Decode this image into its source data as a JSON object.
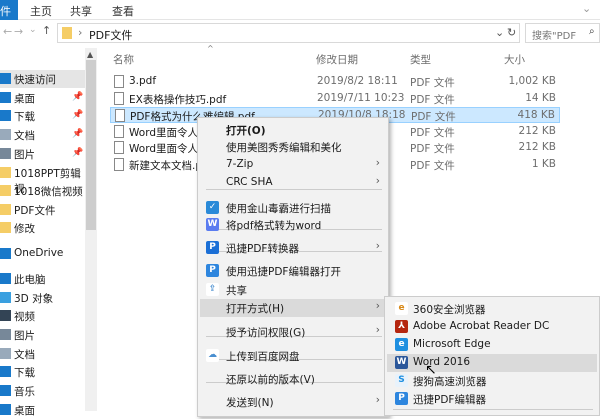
{
  "ribbon": {
    "file_tab": "件",
    "tabs": [
      "主页",
      "共享",
      "查看"
    ]
  },
  "address": {
    "path": "PDF文件",
    "search_placeholder": "搜索\"PDF"
  },
  "nav": {
    "items": [
      {
        "label": "快速访问",
        "pin": false
      },
      {
        "label": "桌面",
        "pin": true
      },
      {
        "label": "下载",
        "pin": true
      },
      {
        "label": "文档",
        "pin": true
      },
      {
        "label": "图片",
        "pin": true
      },
      {
        "label": "1018PPT剪辑视",
        "pin": false
      },
      {
        "label": "1018微信视频",
        "pin": false
      },
      {
        "label": "PDF文件",
        "pin": false
      },
      {
        "label": "修改",
        "pin": false
      },
      {
        "label": "OneDrive",
        "pin": false
      },
      {
        "label": "此电脑",
        "pin": false
      },
      {
        "label": "3D 对象",
        "pin": false
      },
      {
        "label": "视频",
        "pin": false
      },
      {
        "label": "图片",
        "pin": false
      },
      {
        "label": "文档",
        "pin": false
      },
      {
        "label": "下载",
        "pin": false
      },
      {
        "label": "音乐",
        "pin": false
      },
      {
        "label": "桌面",
        "pin": false
      }
    ]
  },
  "columns": {
    "name": "名称",
    "date": "修改日期",
    "type": "类型",
    "size": "大小"
  },
  "files": [
    {
      "name": "3.pdf",
      "date": "2019/8/2 18:11",
      "type": "PDF 文件",
      "size": "1,002 KB"
    },
    {
      "name": "EX表格操作技巧.pdf",
      "date": "2019/7/11 10:23",
      "type": "PDF 文件",
      "size": "14 KB"
    },
    {
      "name": "PDF格式为什么难编辑.pdf",
      "date": "2019/10/8 18:18",
      "type": "PDF 文件",
      "size": "418 KB"
    },
    {
      "name": "Word里面令人讨",
      "date": "",
      "type": "PDF 文件",
      "size": "212 KB"
    },
    {
      "name": "Word里面令人讨",
      "date": "",
      "type": "PDF 文件",
      "size": "212 KB"
    },
    {
      "name": "新建文本文档.pdf",
      "date": "",
      "type": "PDF 文件",
      "size": "1 KB"
    }
  ],
  "context_menu": {
    "items": [
      {
        "label": "打开(O)",
        "bold": true
      },
      {
        "label": "使用美图秀秀编辑和美化"
      },
      {
        "label": "7-Zip",
        "submenu": true
      },
      {
        "label": "CRC SHA",
        "submenu": true
      },
      {
        "label": "使用金山毒霸进行扫描",
        "icon": "kingsoft-icon"
      },
      {
        "label": "将pdf格式转为word",
        "icon": "convert-icon"
      },
      {
        "label": "迅捷PDF转换器",
        "icon": "xunjie-icon",
        "submenu": true
      },
      {
        "label": "使用迅捷PDF编辑器打开",
        "icon": "xunjie-editor-icon"
      },
      {
        "label": "共享",
        "icon": "share-icon"
      },
      {
        "label": "打开方式(H)",
        "submenu": true
      },
      {
        "label": "授予访问权限(G)",
        "submenu": true
      },
      {
        "label": "上传到百度网盘",
        "icon": "baidu-icon"
      },
      {
        "label": "还原以前的版本(V)"
      },
      {
        "label": "发送到(N)",
        "submenu": true
      }
    ]
  },
  "open_with": {
    "items": [
      "360安全浏览器",
      "Adobe Acrobat Reader DC",
      "Microsoft Edge",
      "Word 2016",
      "搜狗高速浏览器",
      "迅捷PDF编辑器"
    ]
  },
  "colors": {
    "accent": "#1979ca",
    "selection": "#cce8ff",
    "menu_bg": "#f2f2f2",
    "highlight": "#dadada"
  }
}
